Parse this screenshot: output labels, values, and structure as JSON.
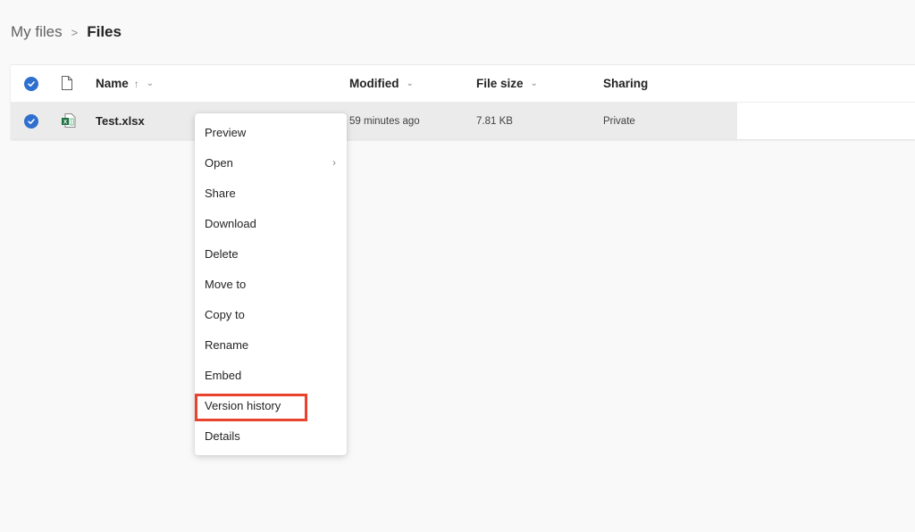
{
  "breadcrumb": {
    "parent": "My files",
    "separator": ">",
    "current": "Files"
  },
  "file_list": {
    "columns": [
      {
        "label": "Name",
        "sort_indicator": "↑",
        "has_dropdown": true
      },
      {
        "label": "Modified",
        "has_dropdown": true
      },
      {
        "label": "File size",
        "has_dropdown": true
      },
      {
        "label": "Sharing",
        "has_dropdown": false
      }
    ],
    "rows": [
      {
        "selected": true,
        "icon": "excel-file-icon",
        "name": "Test.xlsx",
        "modified": "59 minutes ago",
        "file_size": "7.81 KB",
        "sharing": "Private"
      }
    ]
  },
  "context_menu": {
    "items": [
      {
        "label": "Preview"
      },
      {
        "label": "Open",
        "has_submenu": true
      },
      {
        "label": "Share"
      },
      {
        "label": "Download"
      },
      {
        "label": "Delete"
      },
      {
        "label": "Move to"
      },
      {
        "label": "Copy to"
      },
      {
        "label": "Rename"
      },
      {
        "label": "Embed"
      },
      {
        "label": "Version history",
        "highlighted": true
      },
      {
        "label": "Details"
      }
    ]
  },
  "colors": {
    "accent": "#2f6fcd",
    "highlight_border": "#e8432c",
    "excel_green": "#1f7244"
  }
}
